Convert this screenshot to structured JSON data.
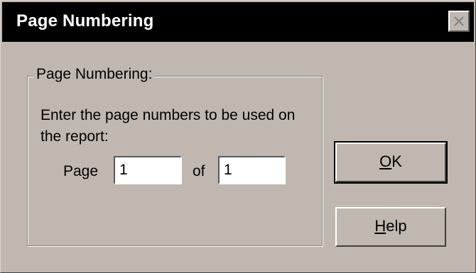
{
  "dialog": {
    "title": "Page Numbering",
    "close_icon": "close-icon"
  },
  "group": {
    "legend": "Page Numbering:",
    "instruction": "Enter the page numbers to be used on the report:",
    "page_label": "Page",
    "page_value": "1",
    "of_label": "of",
    "of_value": "1"
  },
  "buttons": {
    "ok_label": "OK",
    "help_label": "Help"
  },
  "colors": {
    "face": "#c0b8b0",
    "titlebar": "#000000",
    "title_text": "#ffffff"
  }
}
